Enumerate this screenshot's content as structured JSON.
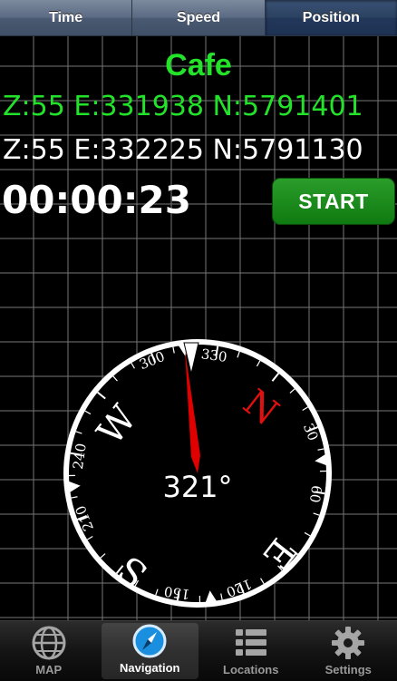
{
  "segments": [
    {
      "label": "Time"
    },
    {
      "label": "Speed"
    },
    {
      "label": "Position"
    }
  ],
  "destination": {
    "name": "Cafe"
  },
  "target_coord": "Z:55 E:331938 N:5791401",
  "current_coord": "Z:55 E:332225 N:5791130",
  "timer": "00:00:23",
  "start_label": "START",
  "compass": {
    "heading": "321°",
    "heading_deg": 321,
    "tick_labels": [
      "300",
      "330",
      "30",
      "60",
      "120",
      "150",
      "210",
      "240"
    ],
    "cardinals": [
      "N",
      "E",
      "S",
      "W"
    ],
    "needle_color": "#e00000",
    "north_color": "#e01010"
  },
  "tabs": [
    {
      "label": "MAP",
      "icon": "globe-icon"
    },
    {
      "label": "Navigation",
      "icon": "compass-icon"
    },
    {
      "label": "Locations",
      "icon": "list-icon"
    },
    {
      "label": "Settings",
      "icon": "gear-icon"
    }
  ],
  "colors": {
    "accent_green": "#23e22a",
    "start_button": "#0f7a10",
    "tab_active_icon": "#1a8fe0"
  }
}
